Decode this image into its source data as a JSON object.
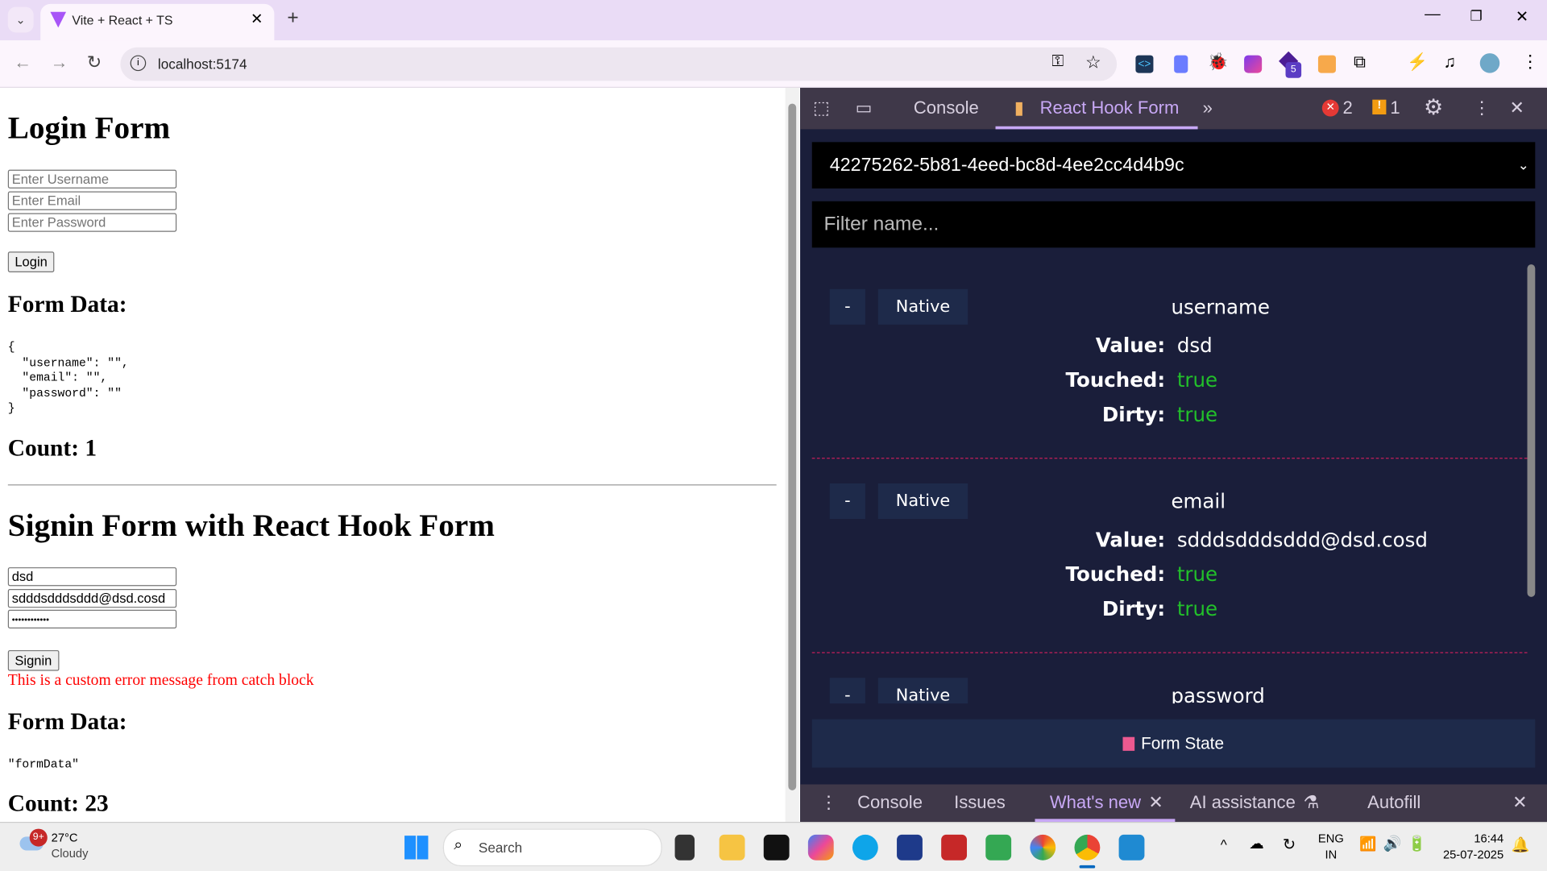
{
  "browser": {
    "tab_title": "Vite + React + TS",
    "url": "localhost:5174",
    "extension_badge": "5"
  },
  "page": {
    "login_title": "Login Form",
    "login_inputs": [
      {
        "placeholder": "Enter Username"
      },
      {
        "placeholder": "Enter Email"
      },
      {
        "placeholder": "Enter Password"
      }
    ],
    "login_button": "Login",
    "form_data_title": "Form Data:",
    "login_form_data": "{\n  \"username\": \"\",\n  \"email\": \"\",\n  \"password\": \"\"\n}",
    "login_count": "Count: 1",
    "signin_title": "Signin Form with React Hook Form",
    "signin_inputs": [
      {
        "value": "dsd"
      },
      {
        "value": "sdddsdddsddd@dsd.cosd"
      },
      {
        "value": "••••••••••••"
      }
    ],
    "signin_button": "Signin",
    "error_message": "This is a custom error message from catch block",
    "form_data_title2": "Form Data:",
    "signin_form_data": "\"formData\"",
    "signin_count": "Count: 23"
  },
  "devtools": {
    "tabs": {
      "console": "Console",
      "rhf": "React Hook Form"
    },
    "errors": "2",
    "warnings": "1",
    "form_id": "42275262-5b81-4eed-bc8d-4ee2cc4d4b9c",
    "filter_placeholder": "Filter name...",
    "labels": {
      "value": "Value:",
      "touched": "Touched:",
      "dirty": "Dirty:"
    },
    "collapse": "-",
    "native": "Native",
    "fields": [
      {
        "name": "username",
        "value": "dsd",
        "touched": "true",
        "dirty": "true"
      },
      {
        "name": "email",
        "value": "sdddsdddsddd@dsd.cosd",
        "touched": "true",
        "dirty": "true"
      },
      {
        "name": "password"
      }
    ],
    "form_state": "Form State",
    "drawer_tabs": {
      "console": "Console",
      "issues": "Issues",
      "whats_new": "What's new",
      "ai": "AI assistance",
      "autofill": "Autofill"
    },
    "colors": {
      "true": "#22c02a",
      "accent": "#c8a8f5",
      "form_state": "#ec5990"
    }
  },
  "taskbar": {
    "temp": "27°C",
    "weather": "Cloudy",
    "weather_badge": "9+",
    "search": "Search",
    "lang1": "ENG",
    "lang2": "IN",
    "time": "16:44",
    "date": "25-07-2025"
  }
}
